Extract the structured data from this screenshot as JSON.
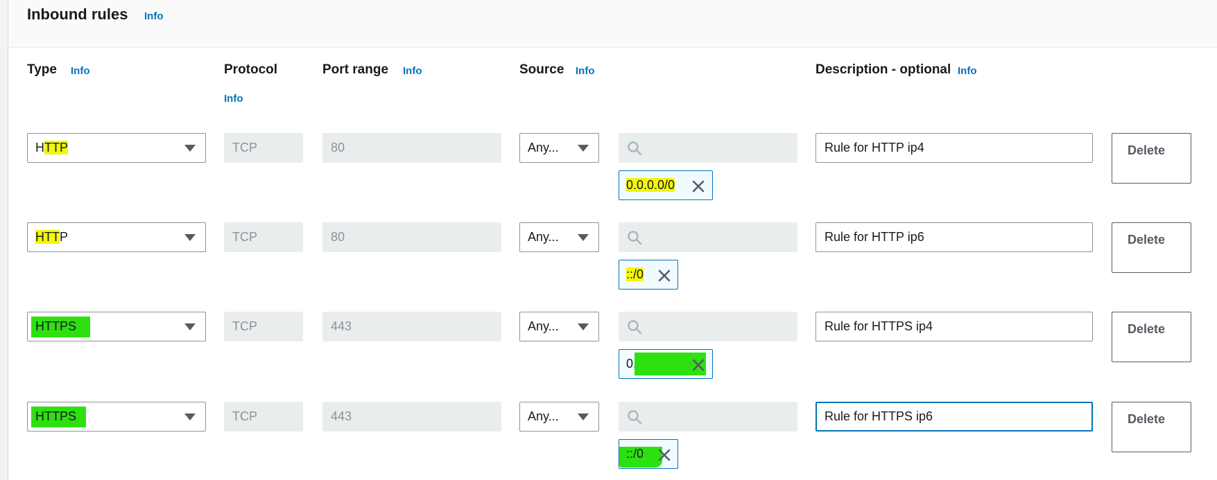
{
  "header": {
    "title": "Inbound rules",
    "info": "Info"
  },
  "columns": {
    "type": "Type",
    "protocol": "Protocol",
    "port_range": "Port range",
    "source": "Source",
    "description": "Description - optional",
    "info": "Info"
  },
  "rules": [
    {
      "type": "HTTP",
      "protocol": "TCP",
      "port": "80",
      "source_mode": "Any...",
      "cidr": "0.0.0.0/0",
      "description": "Rule for HTTP ip4",
      "delete": "Delete"
    },
    {
      "type": "HTTP",
      "protocol": "TCP",
      "port": "80",
      "source_mode": "Any...",
      "cidr": "::/0",
      "description": "Rule for HTTP ip6",
      "delete": "Delete"
    },
    {
      "type": "HTTPS",
      "protocol": "TCP",
      "port": "443",
      "source_mode": "Any...",
      "cidr": "0.0.0.0/0",
      "description": "Rule for HTTPS ip4",
      "delete": "Delete"
    },
    {
      "type": "HTTPS",
      "protocol": "TCP",
      "port": "443",
      "source_mode": "Any...",
      "cidr": "::/0",
      "description": "Rule for HTTPS ip6",
      "delete": "Delete"
    }
  ],
  "icons": {
    "search": "search-icon",
    "remove": "close-icon",
    "dropdown": "caret-down-icon"
  },
  "colors": {
    "link": "#0073bb",
    "focus_border": "#0073bb",
    "highlight_yellow": "#f3f70a",
    "highlight_green": "#2ee010"
  }
}
